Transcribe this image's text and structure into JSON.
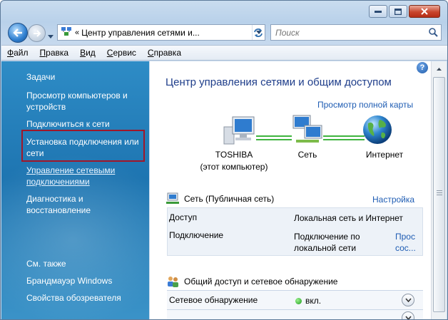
{
  "window": {
    "caption_buttons": [
      "minimize",
      "maximize",
      "close"
    ]
  },
  "address_bar": {
    "chevron": "«",
    "path": "Центр управления сетями и..."
  },
  "search": {
    "placeholder": "Поиск"
  },
  "menu": [
    "Файл",
    "Правка",
    "Вид",
    "Сервис",
    "Справка"
  ],
  "sidebar": {
    "tasks_heading": "Задачи",
    "items": [
      "Просмотр компьютеров и устройств",
      "Подключиться к сети",
      "Установка подключения или сети",
      "Управление сетевыми подключениями",
      "Диагностика и восстановление"
    ],
    "see_also_heading": "См. также",
    "see_also": [
      "Брандмауэр Windows",
      "Свойства обозревателя"
    ]
  },
  "content": {
    "title": "Центр управления сетями и общим доступом",
    "full_map_link": "Просмотр полной карты",
    "map": {
      "computer_name": "TOSHIBA",
      "computer_sub": "(этот компьютер)",
      "network": "Сеть",
      "internet": "Интернет"
    },
    "network_section": {
      "title": "Сеть (Публичная сеть)",
      "settings_link": "Настройка",
      "access_label": "Доступ",
      "access_value": "Локальная сеть и Интернет",
      "connection_label": "Подключение",
      "connection_value_1": "Подключение по",
      "connection_value_2": "локальной сети",
      "connection_link_1": "Прос",
      "connection_link_2": "сос..."
    },
    "sharing_section": {
      "title": "Общий доступ и сетевое обнаружение",
      "discovery_label": "Сетевое обнаружение",
      "discovery_value": "вкл."
    }
  },
  "icons": {
    "help": "?"
  }
}
